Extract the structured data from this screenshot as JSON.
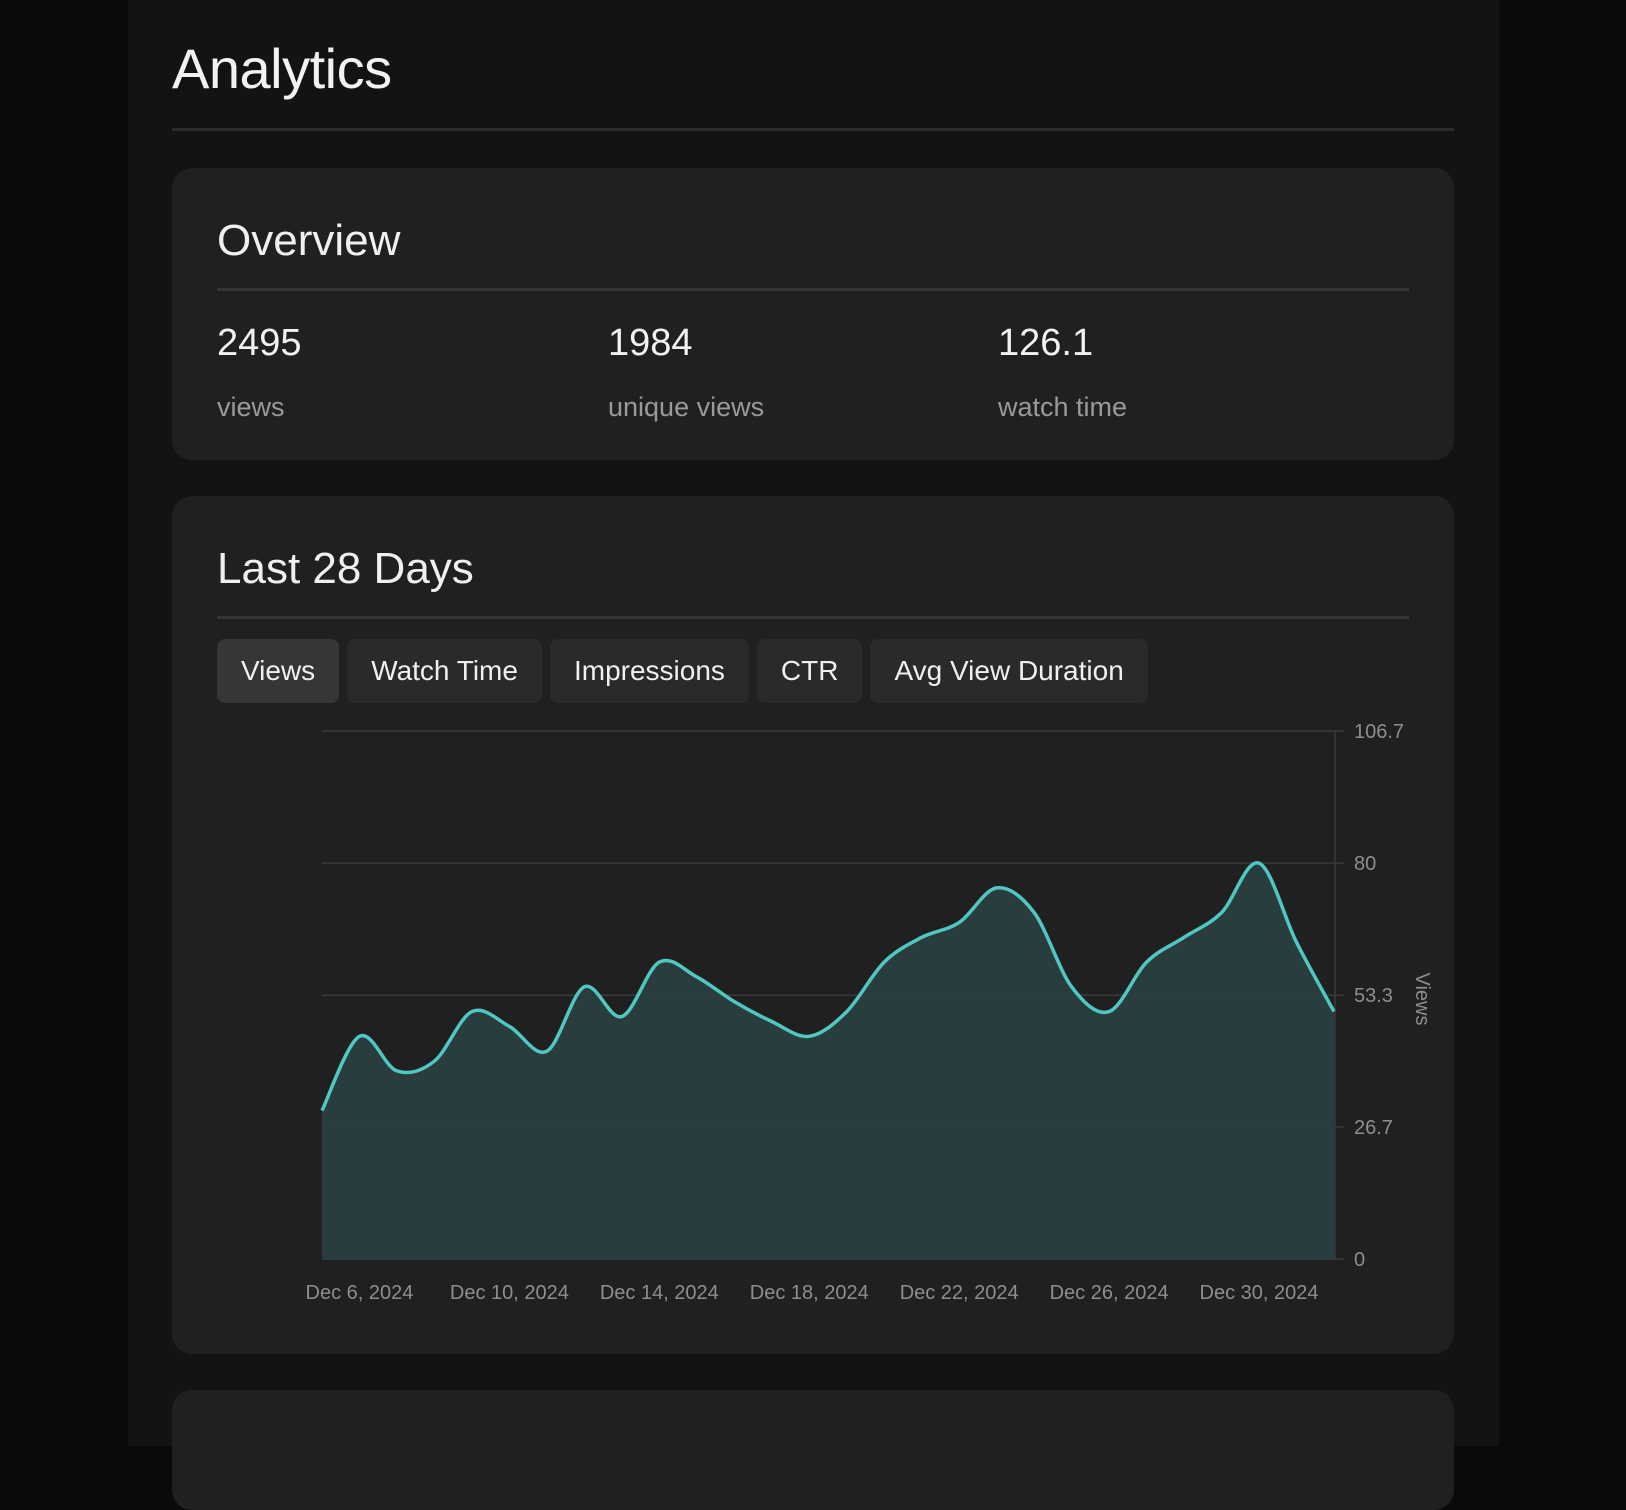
{
  "page": {
    "title": "Analytics"
  },
  "overview": {
    "title": "Overview",
    "stats": [
      {
        "value": "2495",
        "label": "views"
      },
      {
        "value": "1984",
        "label": "unique views"
      },
      {
        "value": "126.1",
        "label": "watch time"
      }
    ]
  },
  "chart_card": {
    "title": "Last 28 Days",
    "tabs": [
      {
        "label": "Views",
        "active": true
      },
      {
        "label": "Watch Time",
        "active": false
      },
      {
        "label": "Impressions",
        "active": false
      },
      {
        "label": "CTR",
        "active": false
      },
      {
        "label": "Avg View Duration",
        "active": false
      }
    ]
  },
  "colors": {
    "line": "#4fc7c3",
    "area": "#2a3e40",
    "grid": "#3a3a3a"
  },
  "chart_data": {
    "type": "area",
    "ylabel": "Views",
    "ylim": [
      0,
      106.7
    ],
    "yticks": [
      "0",
      "26.7",
      "53.3",
      "80",
      "106.7"
    ],
    "ytick_values": [
      0,
      26.7,
      53.3,
      80,
      106.7
    ],
    "xlim": [
      "Dec 5, 2024",
      "Jan 1, 2025"
    ],
    "xticks": [
      "Dec 6, 2024",
      "Dec 10, 2024",
      "Dec 14, 2024",
      "Dec 18, 2024",
      "Dec 22, 2024",
      "Dec 26, 2024",
      "Dec 30, 2024"
    ],
    "xtick_dates": [
      "2024-12-06",
      "2024-12-10",
      "2024-12-14",
      "2024-12-18",
      "2024-12-22",
      "2024-12-26",
      "2024-12-30"
    ],
    "grid": true,
    "series": [
      {
        "x": [
          "2024-12-05",
          "2024-12-06",
          "2024-12-07",
          "2024-12-08",
          "2024-12-09",
          "2024-12-10",
          "2024-12-11",
          "2024-12-12",
          "2024-12-13",
          "2024-12-14",
          "2024-12-15",
          "2024-12-16",
          "2024-12-17",
          "2024-12-18",
          "2024-12-19",
          "2024-12-20",
          "2024-12-21",
          "2024-12-22",
          "2024-12-23",
          "2024-12-24",
          "2024-12-25",
          "2024-12-26",
          "2024-12-27",
          "2024-12-28",
          "2024-12-29",
          "2024-12-30",
          "2024-12-31",
          "2025-01-01"
        ],
        "values": [
          30,
          45,
          38,
          40,
          50,
          47,
          42,
          55,
          49,
          60,
          57,
          52,
          48,
          45,
          50,
          60,
          65,
          68,
          75,
          70,
          55,
          50,
          60,
          65,
          70,
          80,
          64,
          50
        ]
      }
    ]
  }
}
